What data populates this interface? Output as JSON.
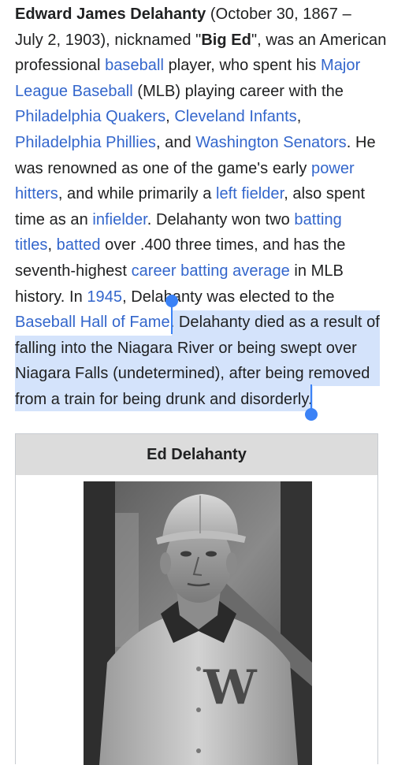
{
  "article": {
    "lines": [
      [
        {
          "t": "Edward James Delahanty",
          "s": "bold"
        },
        {
          "t": " (October 30, 1867 –"
        }
      ],
      [
        {
          "t": "July 2, 1903), nicknamed \""
        },
        {
          "t": "Big Ed",
          "s": "bold"
        },
        {
          "t": "\", was an American"
        }
      ],
      [
        {
          "t": "professional "
        },
        {
          "t": "baseball",
          "s": "link"
        },
        {
          "t": " player, who spent his "
        },
        {
          "t": "Major",
          "s": "link"
        }
      ],
      [
        {
          "t": "League Baseball",
          "s": "link"
        },
        {
          "t": " (MLB) playing career with the"
        }
      ],
      [
        {
          "t": "Philadelphia Quakers",
          "s": "link"
        },
        {
          "t": ", "
        },
        {
          "t": "Cleveland Infants",
          "s": "link"
        },
        {
          "t": ","
        }
      ],
      [
        {
          "t": "Philadelphia Phillies",
          "s": "link"
        },
        {
          "t": ", and "
        },
        {
          "t": "Washington Senators",
          "s": "link"
        },
        {
          "t": ". He"
        }
      ],
      [
        {
          "t": "was renowned as one of the game's early "
        },
        {
          "t": "power",
          "s": "link"
        }
      ],
      [
        {
          "t": "hitters",
          "s": "link"
        },
        {
          "t": ", and while primarily a "
        },
        {
          "t": "left fielder",
          "s": "link"
        },
        {
          "t": ", also spent"
        }
      ],
      [
        {
          "t": "time as an "
        },
        {
          "t": "infielder",
          "s": "link"
        },
        {
          "t": ". Delahanty won two "
        },
        {
          "t": "batting",
          "s": "link"
        }
      ],
      [
        {
          "t": "titles",
          "s": "link"
        },
        {
          "t": ", "
        },
        {
          "t": "batted",
          "s": "link"
        },
        {
          "t": " over .400 three times, and has the"
        }
      ],
      [
        {
          "t": "seventh-highest "
        },
        {
          "t": "career batting average",
          "s": "link"
        },
        {
          "t": " in MLB"
        }
      ],
      [
        {
          "t": "history. In "
        },
        {
          "t": "1945",
          "s": "link"
        },
        {
          "t": ", Delahanty was elected to the"
        }
      ],
      [
        {
          "t": "Baseball Hall of Fame",
          "s": "link"
        },
        {
          "t": ". "
        },
        {
          "t": "Delahanty died as a result of",
          "s": "sel"
        }
      ],
      [
        {
          "t": "falling into the Niagara River or being swept over",
          "s": "sel"
        }
      ],
      [
        {
          "t": "Niagara Falls (undetermined), after being removed",
          "s": "sel"
        }
      ],
      [
        {
          "t": "from a train for being drunk and disorderly.",
          "s": "sel"
        }
      ]
    ]
  },
  "infobox": {
    "title": "Ed Delahanty",
    "photo_alt_icon": "portrait-photo"
  },
  "colors": {
    "link": "#3366cc",
    "selection": "#d4e3fb",
    "handle": "#3b82f6",
    "infobox_header": "#dcdcdc"
  }
}
